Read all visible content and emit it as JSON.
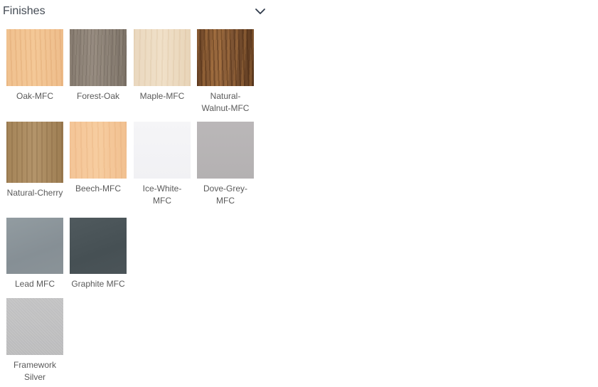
{
  "section": {
    "title": "Finishes",
    "toggle_icon": "chevron-down-icon"
  },
  "finishes": [
    {
      "label": "Oak-MFC",
      "texture": "oak",
      "color": "#f2c491"
    },
    {
      "label": "Forest-Oak",
      "texture": "forest-oak",
      "color": "#8c8176"
    },
    {
      "label": "Maple-MFC",
      "texture": "maple",
      "color": "#ecdac2"
    },
    {
      "label": "Natural-Walnut-MFC",
      "texture": "natural-walnut",
      "color": "#7d5533"
    },
    {
      "label": "Natural-Cherry",
      "texture": "natural-cherry",
      "color": "#a88a5e"
    },
    {
      "label": "Beech-MFC",
      "texture": "beech",
      "color": "#f5c89a"
    },
    {
      "label": "Ice-White-MFC",
      "texture": "ice-white",
      "color": "#f3f3f6"
    },
    {
      "label": "Dove-Grey-MFC",
      "texture": "dove-grey",
      "color": "#b7b4b5"
    },
    {
      "label": "Lead MFC",
      "texture": "lead",
      "color": "#8b9499"
    },
    {
      "label": "Graphite MFC",
      "texture": "graphite",
      "color": "#4b5458"
    },
    {
      "label": "Framework Silver",
      "texture": "framework-silver",
      "color": "#bfbfc0"
    }
  ]
}
